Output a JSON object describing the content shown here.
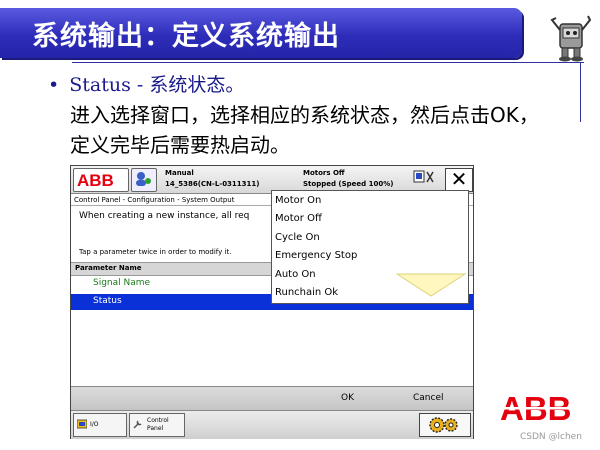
{
  "slide": {
    "title": "系统输出：定义系统输出",
    "bullet": "Status - 系统状态。",
    "description": "进入选择窗口，选择相应的系统状态，然后点击OK，定义完毕后需要热启动。",
    "watermark": "CSDN @lchen"
  },
  "flexpendant": {
    "status": {
      "mode": "Manual",
      "controller": "14_5386(CN-L-0311311)",
      "motors": "Motors Off",
      "state": "Stopped (Speed 100%)"
    },
    "breadcrumb": "Control Panel - Configuration - System Output",
    "info_text": "When creating a new instance, all req",
    "hint_text": "Tap a parameter twice in order to modify it.",
    "column_header": "Parameter Name",
    "rows": [
      {
        "label": "Signal Name"
      },
      {
        "label": "Status"
      }
    ],
    "dropdown_options": [
      "Motor On",
      "Motor Off",
      "Cycle On",
      "Emergency Stop",
      "Auto On",
      "Runchain Ok"
    ],
    "ok_label": "OK",
    "cancel_label": "Cancel",
    "taskbar": {
      "io_label": "I/O",
      "control_panel_line1": "Control",
      "control_panel_line2": "Panel"
    }
  },
  "brand": {
    "logo_text": "ABB",
    "logo_color": "#e4000f"
  },
  "colors": {
    "title_bar": "#2d2dba",
    "selection": "#0a30d8",
    "signal_text": "#1a7a1a"
  }
}
